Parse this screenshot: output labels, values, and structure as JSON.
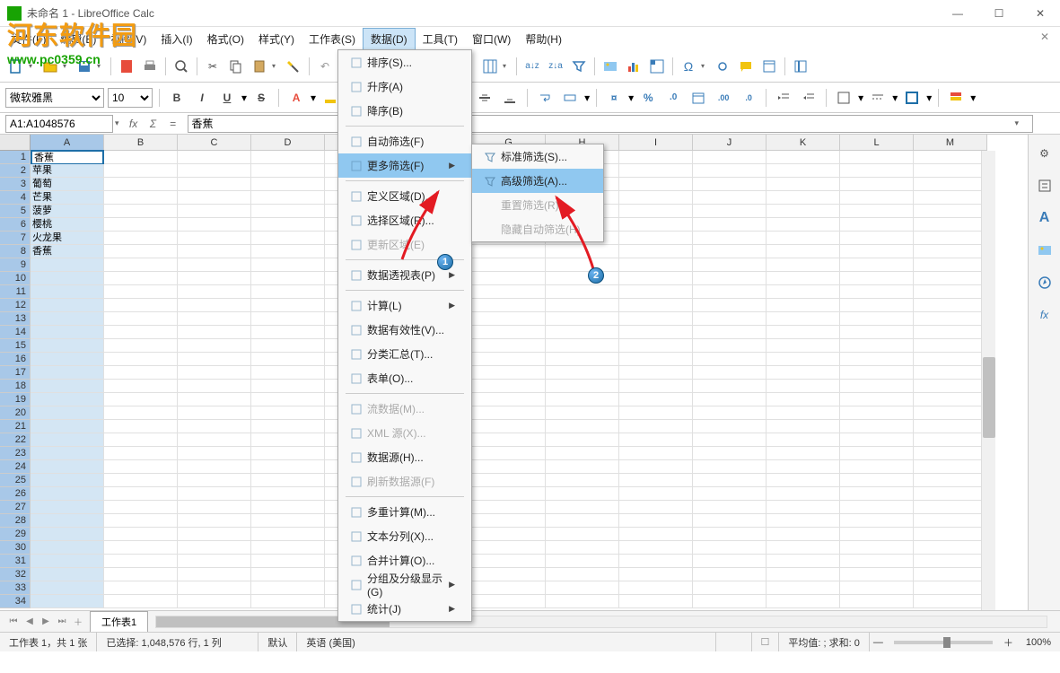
{
  "title": "未命名 1 - LibreOffice Calc",
  "watermark": {
    "text": "河东软件园",
    "url": "www.pc0359.cn"
  },
  "menubar": [
    "文件(F)",
    "编辑(E)",
    "视图(V)",
    "插入(I)",
    "格式(O)",
    "样式(Y)",
    "工作表(S)",
    "数据(D)",
    "工具(T)",
    "窗口(W)",
    "帮助(H)"
  ],
  "menubar_active_index": 7,
  "font": {
    "name": "微软雅黑",
    "size": "10"
  },
  "cellref": {
    "name": "A1:A1048576",
    "formula": "香蕉"
  },
  "columns": [
    "A",
    "B",
    "C",
    "D",
    "E",
    "F",
    "G",
    "H",
    "I",
    "J",
    "K",
    "L",
    "M"
  ],
  "col_data": [
    "香蕉",
    "苹果",
    "葡萄",
    "芒果",
    "菠萝",
    "樱桃",
    "火龙果",
    "香蕉"
  ],
  "menu1_items": [
    {
      "label": "排序(S)...",
      "icon": "sort"
    },
    {
      "label": "升序(A)",
      "icon": "asc"
    },
    {
      "label": "降序(B)",
      "icon": "desc"
    },
    {
      "sep": true
    },
    {
      "label": "自动筛选(F)",
      "icon": "filter"
    },
    {
      "label": "更多筛选(F)",
      "icon": "",
      "arrow": true,
      "highlight": true
    },
    {
      "sep": true
    },
    {
      "label": "定义区域(D)...",
      "icon": "range"
    },
    {
      "label": "选择区域(R)...",
      "icon": "range"
    },
    {
      "label": "更新区域(E)",
      "icon": "refresh",
      "disabled": true
    },
    {
      "sep": true
    },
    {
      "label": "数据透视表(P)",
      "icon": "pivot",
      "arrow": true
    },
    {
      "sep": true
    },
    {
      "label": "计算(L)",
      "icon": "calc",
      "arrow": true
    },
    {
      "label": "数据有效性(V)...",
      "icon": "validity"
    },
    {
      "label": "分类汇总(T)...",
      "icon": "subtotal"
    },
    {
      "label": "表单(O)...",
      "icon": "form"
    },
    {
      "sep": true
    },
    {
      "label": "流数据(M)...",
      "icon": "stream",
      "disabled": true
    },
    {
      "label": "XML 源(X)...",
      "icon": "xml",
      "disabled": true
    },
    {
      "label": "数据源(H)...",
      "icon": "ds"
    },
    {
      "label": "刷新数据源(F)",
      "icon": "refresh",
      "disabled": true
    },
    {
      "sep": true
    },
    {
      "label": "多重计算(M)...",
      "icon": ""
    },
    {
      "label": "文本分列(X)...",
      "icon": "textcol"
    },
    {
      "label": "合并计算(O)...",
      "icon": "cons"
    },
    {
      "label": "分组及分级显示(G)",
      "icon": "group",
      "arrow": true
    },
    {
      "label": "统计(J)",
      "icon": "stats",
      "arrow": true
    }
  ],
  "menu2_items": [
    {
      "label": "标准筛选(S)...",
      "icon": "funnel"
    },
    {
      "label": "高级筛选(A)...",
      "icon": "funnel2",
      "highlight": true
    },
    {
      "label": "重置筛选(R)",
      "icon": "",
      "disabled": true
    },
    {
      "label": "隐藏自动筛选(H)",
      "icon": "",
      "disabled": true
    }
  ],
  "sheettab": "工作表1",
  "status": {
    "sheet": "工作表 1，共 1 张",
    "selection": "已选择: 1,048,576 行, 1 列",
    "style": "默认",
    "lang": "英语 (美国)",
    "insert": "",
    "stats": "平均值: ; 求和: 0",
    "zoom": "100%"
  },
  "badges": {
    "b1": "1",
    "b2": "2"
  }
}
